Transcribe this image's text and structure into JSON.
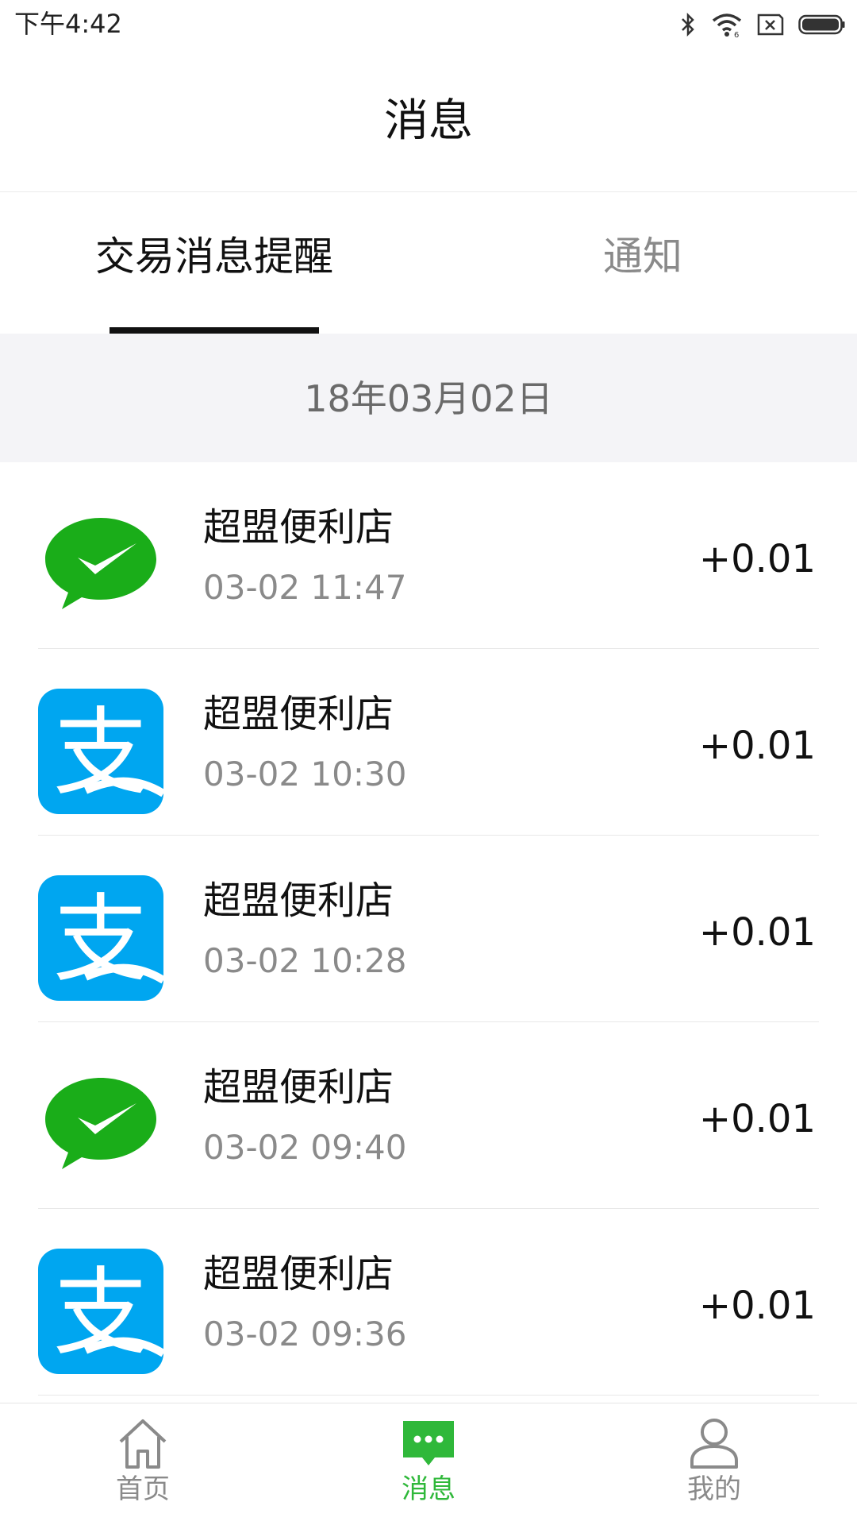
{
  "status_bar": {
    "time": "下午4:42",
    "icons": [
      "bluetooth-icon",
      "wifi-icon",
      "sim-off-icon",
      "battery-icon"
    ]
  },
  "header": {
    "title": "消息"
  },
  "tabs": [
    {
      "label": "交易消息提醒",
      "active": true
    },
    {
      "label": "通知",
      "active": false
    }
  ],
  "date_section": {
    "label": "18年03月02日"
  },
  "transactions": [
    {
      "icon": "wechat-pay-icon",
      "merchant": "超盟便利店",
      "time": "03-02 11:47",
      "amount": "+0.01"
    },
    {
      "icon": "alipay-icon",
      "merchant": "超盟便利店",
      "time": "03-02 10:30",
      "amount": "+0.01"
    },
    {
      "icon": "alipay-icon",
      "merchant": "超盟便利店",
      "time": "03-02 10:28",
      "amount": "+0.01"
    },
    {
      "icon": "wechat-pay-icon",
      "merchant": "超盟便利店",
      "time": "03-02 09:40",
      "amount": "+0.01"
    },
    {
      "icon": "alipay-icon",
      "merchant": "超盟便利店",
      "time": "03-02 09:36",
      "amount": "+0.01"
    }
  ],
  "bottom_nav": [
    {
      "label": "首页",
      "icon": "home-icon",
      "active": false
    },
    {
      "label": "消息",
      "icon": "message-icon",
      "active": true
    },
    {
      "label": "我的",
      "icon": "user-icon",
      "active": false
    }
  ],
  "colors": {
    "accent_green": "#2fb83a",
    "wechat_green": "#1aad19",
    "alipay_blue": "#00a6f0"
  }
}
